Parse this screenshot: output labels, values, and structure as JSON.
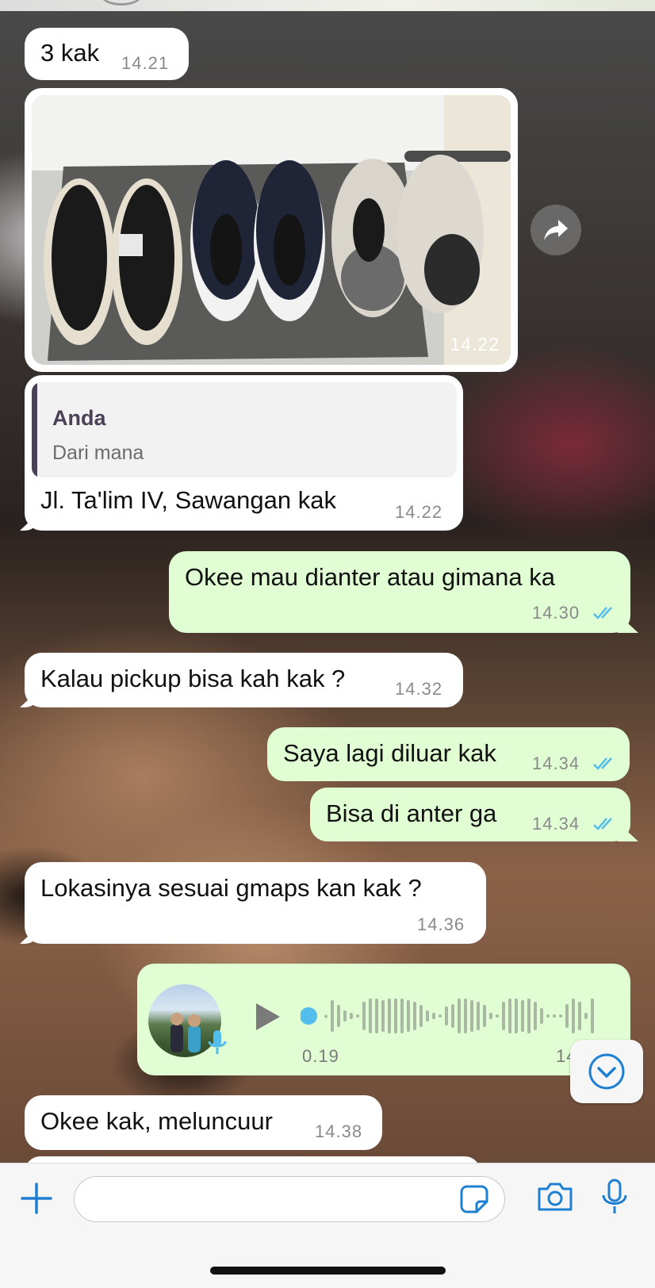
{
  "messages": {
    "m1": {
      "text": "3 kak",
      "time": "14.21"
    },
    "photo": {
      "time": "14.22"
    },
    "reply": {
      "quote_author": "Anda",
      "quote_text": "Dari mana",
      "text": "Jl. Ta'lim IV, Sawangan kak",
      "time": "14.22"
    },
    "m3": {
      "text": "Okee mau dianter atau gimana ka",
      "time": "14.30"
    },
    "m4": {
      "text": "Kalau pickup bisa kah kak ?",
      "time": "14.32"
    },
    "m5": {
      "text": "Saya lagi diluar kak",
      "time": "14.34"
    },
    "m6": {
      "text": "Bisa di anter ga",
      "time": "14.34"
    },
    "m7": {
      "text": "Lokasinya sesuai gmaps kan kak ?",
      "time": "14.36"
    },
    "voice": {
      "duration": "0.19",
      "time": "14.3",
      "progress": 0
    },
    "m8": {
      "text": "Okee kak, meluncuur",
      "time": "14.38"
    }
  },
  "composer": {
    "placeholder": ""
  },
  "icons": {
    "add": "plus-icon",
    "sticker": "sticker-icon",
    "camera": "camera-icon",
    "mic": "microphone-icon",
    "forward": "forward-arrow-icon",
    "scroll": "chevron-down-icon",
    "read": "double-check-icon",
    "play": "play-icon"
  },
  "colors": {
    "incoming": "#ffffff",
    "outgoing": "#e1fdd3",
    "read_ticks": "#53bdeb",
    "accent": "#1f7fd1"
  }
}
